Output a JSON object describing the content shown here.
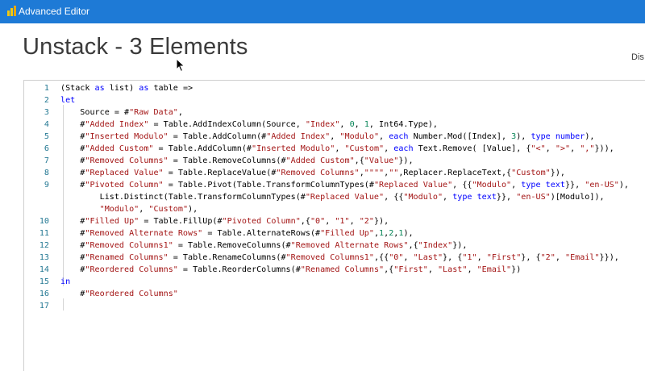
{
  "window": {
    "title": "Advanced Editor",
    "accent": "#1e7ad6"
  },
  "header": {
    "query_name": "Unstack - 3 Elements",
    "display_options_label": "Dis"
  },
  "editor": {
    "lines": [
      {
        "no": "1",
        "parts": [
          [
            "t",
            "(Stack "
          ],
          [
            "k",
            "as"
          ],
          [
            "t",
            " list) "
          ],
          [
            "k",
            "as"
          ],
          [
            "t",
            " table =>"
          ]
        ]
      },
      {
        "no": "2",
        "parts": [
          [
            "k",
            "let"
          ]
        ]
      },
      {
        "no": "3",
        "parts": [
          [
            "t",
            "    Source = #"
          ],
          [
            "s",
            "\"Raw Data\""
          ],
          [
            "t",
            ","
          ]
        ]
      },
      {
        "no": "4",
        "parts": [
          [
            "t",
            "    #"
          ],
          [
            "s",
            "\"Added Index\""
          ],
          [
            "t",
            " = Table.AddIndexColumn(Source, "
          ],
          [
            "s",
            "\"Index\""
          ],
          [
            "t",
            ", "
          ],
          [
            "n",
            "0"
          ],
          [
            "t",
            ", "
          ],
          [
            "n",
            "1"
          ],
          [
            "t",
            ", Int64.Type),"
          ]
        ]
      },
      {
        "no": "5",
        "parts": [
          [
            "t",
            "    #"
          ],
          [
            "s",
            "\"Inserted Modulo\""
          ],
          [
            "t",
            " = Table.AddColumn(#"
          ],
          [
            "s",
            "\"Added Index\""
          ],
          [
            "t",
            ", "
          ],
          [
            "s",
            "\"Modulo\""
          ],
          [
            "t",
            ", "
          ],
          [
            "k",
            "each"
          ],
          [
            "t",
            " Number.Mod([Index], "
          ],
          [
            "n",
            "3"
          ],
          [
            "t",
            "), "
          ],
          [
            "k",
            "type number"
          ],
          [
            "t",
            "),"
          ]
        ]
      },
      {
        "no": "6",
        "parts": [
          [
            "t",
            "    #"
          ],
          [
            "s",
            "\"Added Custom\""
          ],
          [
            "t",
            " = Table.AddColumn(#"
          ],
          [
            "s",
            "\"Inserted Modulo\""
          ],
          [
            "t",
            ", "
          ],
          [
            "s",
            "\"Custom\""
          ],
          [
            "t",
            ", "
          ],
          [
            "k",
            "each"
          ],
          [
            "t",
            " Text.Remove( [Value], {"
          ],
          [
            "s",
            "\"<\""
          ],
          [
            "t",
            ", "
          ],
          [
            "s",
            "\">\""
          ],
          [
            "t",
            ", "
          ],
          [
            "s",
            "\",\""
          ],
          [
            "t",
            "})),"
          ]
        ]
      },
      {
        "no": "7",
        "parts": [
          [
            "t",
            "    #"
          ],
          [
            "s",
            "\"Removed Columns\""
          ],
          [
            "t",
            " = Table.RemoveColumns(#"
          ],
          [
            "s",
            "\"Added Custom\""
          ],
          [
            "t",
            ",{"
          ],
          [
            "s",
            "\"Value\""
          ],
          [
            "t",
            "}),"
          ]
        ]
      },
      {
        "no": "8",
        "parts": [
          [
            "t",
            "    #"
          ],
          [
            "s",
            "\"Replaced Value\""
          ],
          [
            "t",
            " = Table.ReplaceValue(#"
          ],
          [
            "s",
            "\"Removed Columns\""
          ],
          [
            "t",
            ","
          ],
          [
            "s",
            "\"\"\"\""
          ],
          [
            "t",
            ","
          ],
          [
            "s",
            "\"\""
          ],
          [
            "t",
            ",Replacer.ReplaceText,{"
          ],
          [
            "s",
            "\"Custom\""
          ],
          [
            "t",
            "}),"
          ]
        ]
      },
      {
        "no": "9",
        "parts": [
          [
            "t",
            "    #"
          ],
          [
            "s",
            "\"Pivoted Column\""
          ],
          [
            "t",
            " = Table.Pivot(Table.TransformColumnTypes(#"
          ],
          [
            "s",
            "\"Replaced Value\""
          ],
          [
            "t",
            ", {{"
          ],
          [
            "s",
            "\"Modulo\""
          ],
          [
            "t",
            ", "
          ],
          [
            "k",
            "type text"
          ],
          [
            "t",
            "}}, "
          ],
          [
            "s",
            "\"en-US\""
          ],
          [
            "t",
            "),"
          ]
        ]
      },
      {
        "no": "",
        "parts": [
          [
            "t",
            "        List.Distinct(Table.TransformColumnTypes(#"
          ],
          [
            "s",
            "\"Replaced Value\""
          ],
          [
            "t",
            ", {{"
          ],
          [
            "s",
            "\"Modulo\""
          ],
          [
            "t",
            ", "
          ],
          [
            "k",
            "type text"
          ],
          [
            "t",
            "}}, "
          ],
          [
            "s",
            "\"en-US\""
          ],
          [
            "t",
            ")[Modulo]),"
          ]
        ]
      },
      {
        "no": "",
        "parts": [
          [
            "t",
            "        "
          ],
          [
            "s",
            "\"Modulo\""
          ],
          [
            "t",
            ", "
          ],
          [
            "s",
            "\"Custom\""
          ],
          [
            "t",
            "),"
          ]
        ]
      },
      {
        "no": "10",
        "parts": [
          [
            "t",
            "    #"
          ],
          [
            "s",
            "\"Filled Up\""
          ],
          [
            "t",
            " = Table.FillUp(#"
          ],
          [
            "s",
            "\"Pivoted Column\""
          ],
          [
            "t",
            ",{"
          ],
          [
            "s",
            "\"0\""
          ],
          [
            "t",
            ", "
          ],
          [
            "s",
            "\"1\""
          ],
          [
            "t",
            ", "
          ],
          [
            "s",
            "\"2\""
          ],
          [
            "t",
            "}),"
          ]
        ]
      },
      {
        "no": "11",
        "parts": [
          [
            "t",
            "    #"
          ],
          [
            "s",
            "\"Removed Alternate Rows\""
          ],
          [
            "t",
            " = Table.AlternateRows(#"
          ],
          [
            "s",
            "\"Filled Up\""
          ],
          [
            "t",
            ","
          ],
          [
            "n",
            "1"
          ],
          [
            "t",
            ","
          ],
          [
            "n",
            "2"
          ],
          [
            "t",
            ","
          ],
          [
            "n",
            "1"
          ],
          [
            "t",
            "),"
          ]
        ]
      },
      {
        "no": "12",
        "parts": [
          [
            "t",
            "    #"
          ],
          [
            "s",
            "\"Removed Columns1\""
          ],
          [
            "t",
            " = Table.RemoveColumns(#"
          ],
          [
            "s",
            "\"Removed Alternate Rows\""
          ],
          [
            "t",
            ",{"
          ],
          [
            "s",
            "\"Index\""
          ],
          [
            "t",
            "}),"
          ]
        ]
      },
      {
        "no": "13",
        "parts": [
          [
            "t",
            "    #"
          ],
          [
            "s",
            "\"Renamed Columns\""
          ],
          [
            "t",
            " = Table.RenameColumns(#"
          ],
          [
            "s",
            "\"Removed Columns1\""
          ],
          [
            "t",
            ",{{"
          ],
          [
            "s",
            "\"0\""
          ],
          [
            "t",
            ", "
          ],
          [
            "s",
            "\"Last\""
          ],
          [
            "t",
            "}, {"
          ],
          [
            "s",
            "\"1\""
          ],
          [
            "t",
            ", "
          ],
          [
            "s",
            "\"First\""
          ],
          [
            "t",
            "}, {"
          ],
          [
            "s",
            "\"2\""
          ],
          [
            "t",
            ", "
          ],
          [
            "s",
            "\"Email\""
          ],
          [
            "t",
            "}}),"
          ]
        ]
      },
      {
        "no": "14",
        "parts": [
          [
            "t",
            "    #"
          ],
          [
            "s",
            "\"Reordered Columns\""
          ],
          [
            "t",
            " = Table.ReorderColumns(#"
          ],
          [
            "s",
            "\"Renamed Columns\""
          ],
          [
            "t",
            ",{"
          ],
          [
            "s",
            "\"First\""
          ],
          [
            "t",
            ", "
          ],
          [
            "s",
            "\"Last\""
          ],
          [
            "t",
            ", "
          ],
          [
            "s",
            "\"Email\""
          ],
          [
            "t",
            "})"
          ]
        ]
      },
      {
        "no": "15",
        "parts": [
          [
            "k",
            "in"
          ]
        ]
      },
      {
        "no": "16",
        "parts": [
          [
            "t",
            "    #"
          ],
          [
            "s",
            "\"Reordered Columns\""
          ]
        ]
      },
      {
        "no": "17",
        "parts": []
      }
    ]
  }
}
